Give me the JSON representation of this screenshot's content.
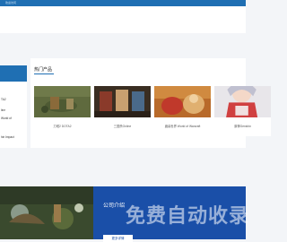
{
  "header": {
    "top_text": "欢迎访问"
  },
  "sidebar": {
    "items": [
      {
        "label": "TA2"
      },
      {
        "label": "line"
      },
      {
        "label": "World of"
      },
      {
        "label": "hin Impact"
      }
    ]
  },
  "products": {
    "title": "热门产品",
    "cards": [
      {
        "caption": "刀塔2 DOTA2"
      },
      {
        "caption": "三国杀Online"
      },
      {
        "caption": "魔兽世界 World of Warcraft"
      },
      {
        "caption": "原神Genshin"
      }
    ]
  },
  "company": {
    "title": "公司介绍",
    "more_label": "更多详情"
  },
  "watermark": "免费自动收录"
}
